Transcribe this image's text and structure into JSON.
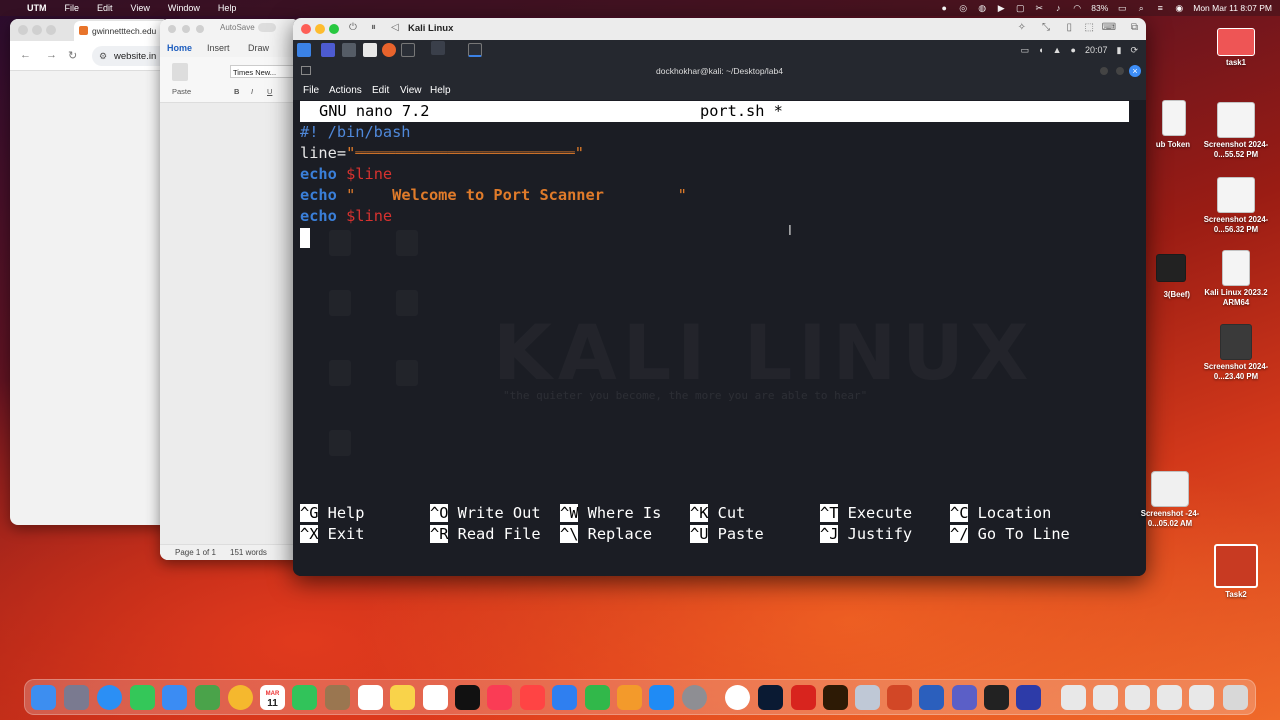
{
  "menubar": {
    "app": "UTM",
    "items": [
      "File",
      "Edit",
      "View",
      "Window",
      "Help"
    ],
    "battery": "83%",
    "clock": "Mon Mar 11  8:07 PM"
  },
  "chrome": {
    "tab_title": "gwinnetttech.edu",
    "url": "website.in"
  },
  "word": {
    "autosave": "AutoSave",
    "tabs": [
      "Home",
      "Insert",
      "Draw"
    ],
    "paste": "Paste",
    "font": "Times New...",
    "fmt": [
      "B",
      "I",
      "U"
    ],
    "page": "Page 1 of 1",
    "words": "151 words"
  },
  "utm": {
    "window_title": "Kali Linux",
    "panel_time": "20:07",
    "terminal_title": "dockhokhar@kali: ~/Desktop/lab4",
    "term_menu": [
      "File",
      "Actions",
      "Edit",
      "View",
      "Help"
    ],
    "watermark": "KALI LINUX",
    "watermark_quote": "\"the quieter you become, the more you are able to hear\""
  },
  "nano": {
    "version": "GNU nano 7.2",
    "filename": "port.sh *",
    "lines": {
      "l1": "#! /bin/bash",
      "l2_var": "line=",
      "l2_q1": "\"",
      "l2_bar": "══════════════════════════════════════",
      "l2_q2": "\"",
      "echo": "echo",
      "var_line": "$line",
      "l4_q1": "\"",
      "l4_text": "    Welcome to Port Scanner",
      "l4_q2": "        \""
    },
    "shortcuts": [
      {
        "key": "^G",
        "label": "Help"
      },
      {
        "key": "^O",
        "label": "Write Out"
      },
      {
        "key": "^W",
        "label": "Where Is"
      },
      {
        "key": "^K",
        "label": "Cut"
      },
      {
        "key": "^T",
        "label": "Execute"
      },
      {
        "key": "^C",
        "label": "Location"
      },
      {
        "key": "^X",
        "label": "Exit"
      },
      {
        "key": "^R",
        "label": "Read File"
      },
      {
        "key": "^\\",
        "label": "Replace"
      },
      {
        "key": "^U",
        "label": "Paste"
      },
      {
        "key": "^J",
        "label": "Justify"
      },
      {
        "key": "^/",
        "label": "Go To Line"
      }
    ]
  },
  "desktop": [
    {
      "label": "task1"
    },
    {
      "label": "ub Token"
    },
    {
      "label": "Screenshot 2024-0...55.52 PM"
    },
    {
      "label": "Screenshot 2024-0...56.32 PM"
    },
    {
      "label": "3(Beef)"
    },
    {
      "label": "Kali Linux 2023.2 ARM64"
    },
    {
      "label": "Screenshot 2024-0...23.40 PM"
    },
    {
      "label": "Screenshot -24-0...05.02 AM"
    },
    {
      "label": "Task2"
    }
  ],
  "dock": {
    "calendar_day": "11",
    "calendar_month": "MAR"
  }
}
